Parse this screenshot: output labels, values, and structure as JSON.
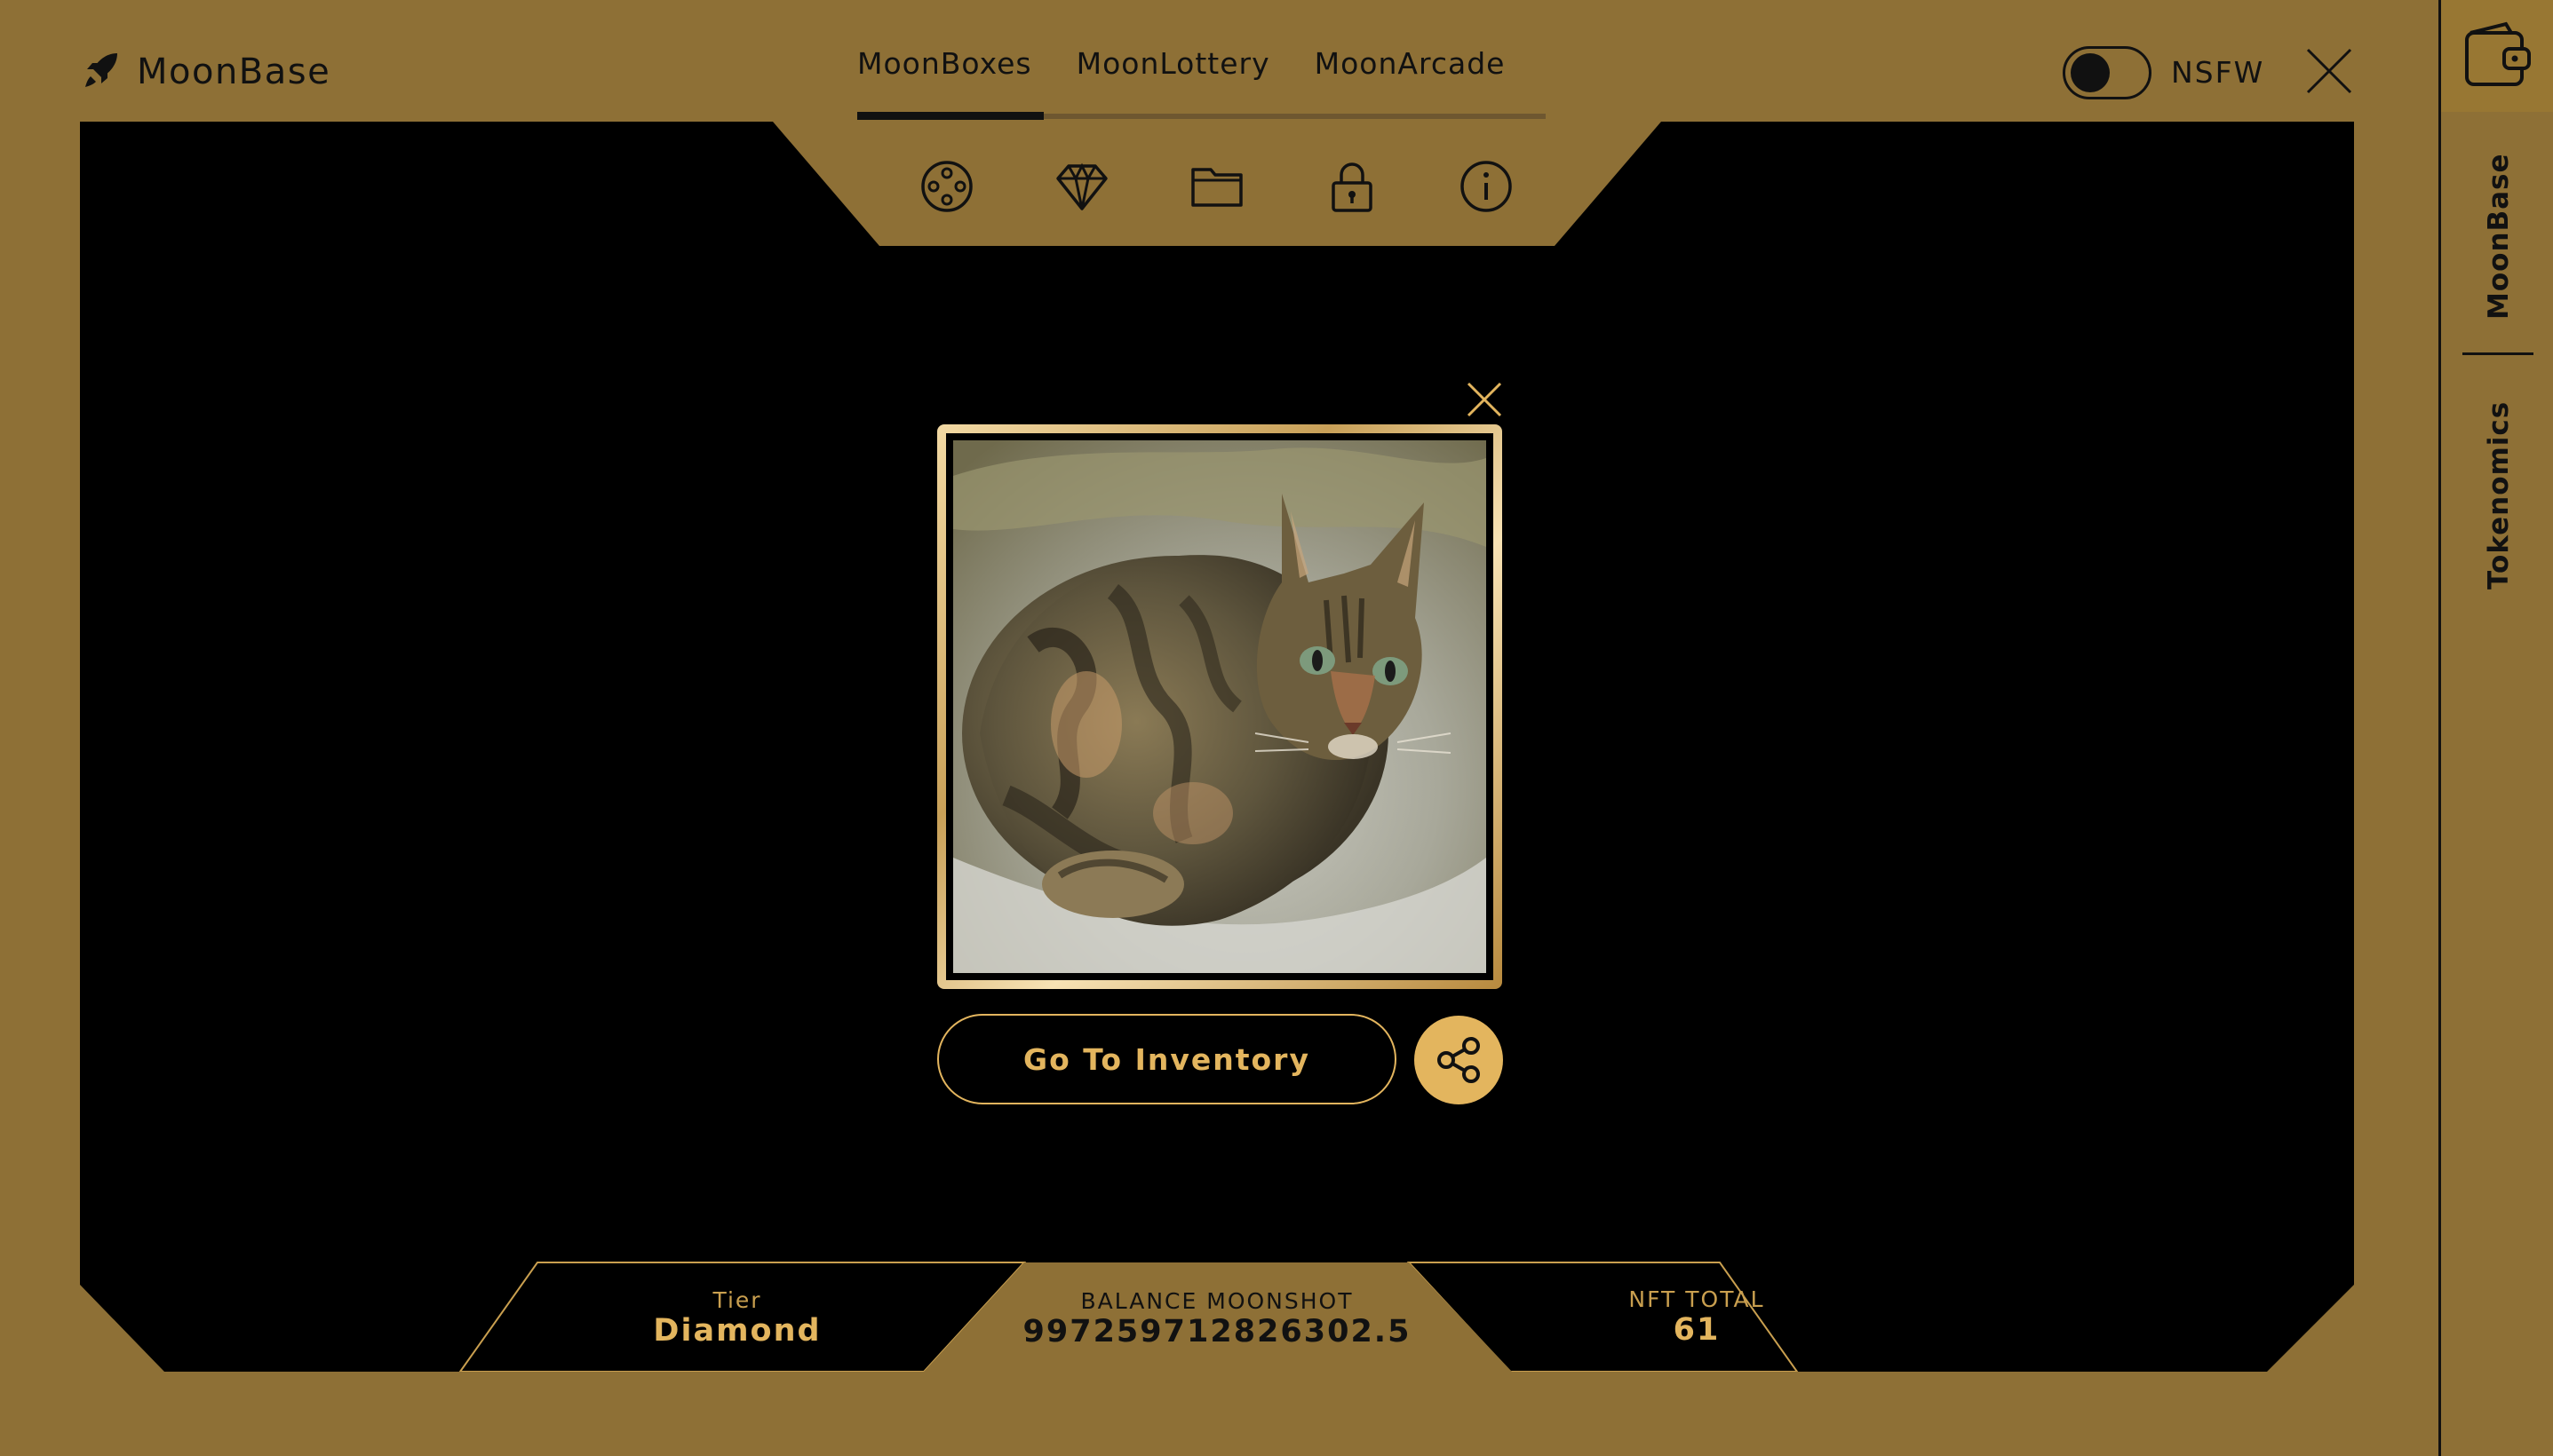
{
  "header": {
    "brand": "MoonBase",
    "tabs": [
      {
        "label": "MoonBoxes",
        "active": true
      },
      {
        "label": "MoonLottery",
        "active": false
      },
      {
        "label": "MoonArcade",
        "active": false
      }
    ],
    "nsfw_label": "NSFW",
    "nsfw_enabled": false
  },
  "sidebar": {
    "links": [
      "MoonBase",
      "Tokenomics"
    ]
  },
  "toolbar": {
    "icons": [
      "gamepad-icon",
      "diamond-icon",
      "folder-icon",
      "lock-icon",
      "info-icon"
    ]
  },
  "modal": {
    "image_description": "painted tabby cat NFT",
    "button_label": "Go To Inventory"
  },
  "stats": {
    "tier": {
      "label": "Tier",
      "value": "Diamond"
    },
    "balance": {
      "label": "BALANCE MOONSHOT",
      "value": "997259712826302.5"
    },
    "nft_total": {
      "label": "NFT TOTAL",
      "value": "61"
    }
  },
  "colors": {
    "background": "#8e7036",
    "panel": "#000000",
    "accent_gold": "#e3b55e"
  }
}
